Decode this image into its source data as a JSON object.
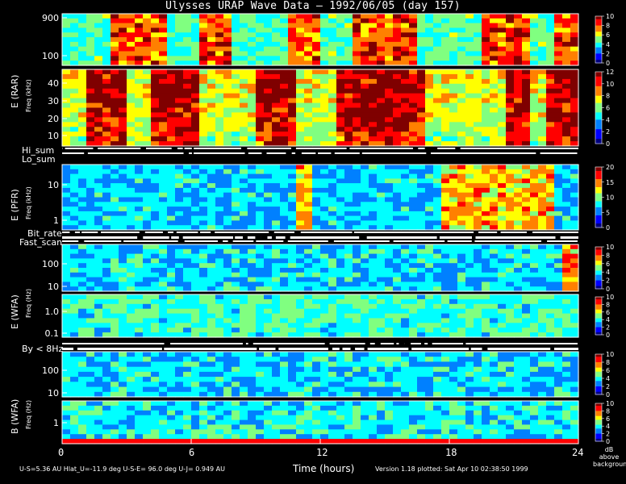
{
  "title": "Ulysses URAP Wave Data – 1992/06/05  (day 157)",
  "x_axis": {
    "label": "Time (hours)",
    "ticks": [
      "0",
      "6",
      "12",
      "18",
      "24"
    ]
  },
  "footer": {
    "ephemeris": "U-S=5.36 AU   Hlat_U=-11.9 deg   U-S-E= 96.0 deg   U-J= 0.949 AU",
    "version": "Version 1.18 plotted: Sat Apr 10 02:38:50 1999"
  },
  "colorbar_unit": [
    "dB",
    "above",
    "background"
  ],
  "row_labels": {
    "hi_sum": "Hi_sum",
    "lo_sum": "Lo_sum",
    "bit_rate": "Bit_rate",
    "fast_scan": "Fast_scan",
    "by_lt_8hz": "By < 8Hz"
  },
  "instrument_labels": {
    "rar": "E (RAR)",
    "pfr": "E (PFR)",
    "wfa_e": "E (WFA)",
    "wfa_b": "B (WFA)"
  },
  "axis_unit_labels": {
    "freq_khz": "Freq (kHz)",
    "freq_hz": "Freq (Hz)"
  },
  "chart_data": {
    "type": "heatmap",
    "title": "Ulysses URAP Wave Data – 1992/06/05  (day 157)",
    "x_range_hours": [
      0,
      24
    ],
    "panels": [
      {
        "id": "rar_high",
        "ylabel": "Freq (kHz)",
        "yticks": [
          "900",
          "100"
        ],
        "colorbar": [
          "10",
          "8",
          "6",
          "4",
          "2",
          "0"
        ],
        "colorbar_range": [
          0,
          10
        ]
      },
      {
        "id": "rar_low",
        "ylabel": "Freq (kHz)",
        "yticks": [
          "40",
          "30",
          "20",
          "10"
        ],
        "colorbar": [
          "12",
          "10",
          "8",
          "6",
          "4",
          "2",
          "0"
        ],
        "colorbar_range": [
          0,
          12
        ]
      },
      {
        "id": "pfr",
        "ylabel": "Freq (kHz)",
        "yticks": [
          "10",
          "1"
        ],
        "colorbar": [
          "20",
          "15",
          "10",
          "5",
          "0"
        ],
        "colorbar_range": [
          0,
          20
        ]
      },
      {
        "id": "wfa_e_high",
        "ylabel": "Freq (Hz)",
        "yticks": [
          "100",
          "10"
        ],
        "colorbar": [
          "10",
          "8",
          "6",
          "4",
          "2",
          "0"
        ],
        "colorbar_range": [
          0,
          10
        ]
      },
      {
        "id": "wfa_e_low",
        "ylabel": "Freq (Hz)",
        "yticks": [
          "1.0",
          "0.1"
        ],
        "colorbar": [
          "10",
          "8",
          "6",
          "4",
          "2",
          "0"
        ],
        "colorbar_range": [
          0,
          10
        ]
      },
      {
        "id": "wfa_b_high",
        "ylabel": "Freq (Hz)",
        "yticks": [
          "100",
          "10"
        ],
        "colorbar": [
          "10",
          "8",
          "6",
          "4",
          "2",
          "0"
        ],
        "colorbar_range": [
          0,
          10
        ]
      },
      {
        "id": "wfa_b_low",
        "ylabel": "Freq (Hz)",
        "yticks": [
          "1"
        ],
        "colorbar": [
          "10",
          "8",
          "6",
          "4",
          "2",
          "0"
        ],
        "colorbar_range": [
          0,
          10
        ]
      }
    ],
    "colormap": [
      "#00007f",
      "#0000ff",
      "#0080ff",
      "#00ffff",
      "#80ff80",
      "#ffff00",
      "#ff8000",
      "#ff0000",
      "#7f0000"
    ]
  }
}
